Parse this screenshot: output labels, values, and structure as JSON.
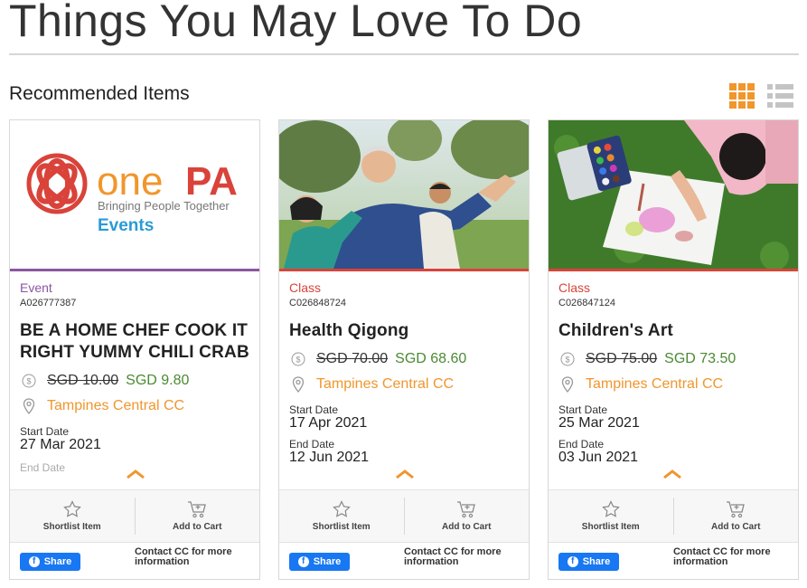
{
  "page": {
    "title": "Things You May Love To Do"
  },
  "section": {
    "title": "Recommended Items"
  },
  "colors": {
    "accent": "#f0962c",
    "event": "#8b56a0",
    "class": "#d9433a",
    "price": "#4a8a32",
    "facebook": "#1877f2"
  },
  "logo": {
    "brand_one": "one",
    "brand_pa": "PA",
    "tagline": "Bringing People Together",
    "sub": "Events"
  },
  "cards": [
    {
      "category": "Event",
      "code": "A026777387",
      "name": "BE A HOME CHEF COOK IT RIGHT YUMMY CHILI CRAB",
      "old_price": "SGD 10.00",
      "new_price": "SGD 9.80",
      "location": "Tampines Central CC",
      "start_label": "Start Date",
      "start_date": "27 Mar 2021",
      "end_label": "End Date",
      "end_date": "",
      "shortlist": "Shortlist Item",
      "add_cart": "Add to Cart",
      "share": "Share",
      "contact": "Contact CC for more information"
    },
    {
      "category": "Class",
      "code": "C026848724",
      "name": "Health Qigong",
      "old_price": "SGD 70.00",
      "new_price": "SGD 68.60",
      "location": "Tampines Central CC",
      "start_label": "Start Date",
      "start_date": "17 Apr 2021",
      "end_label": "End Date",
      "end_date": "12 Jun 2021",
      "shortlist": "Shortlist Item",
      "add_cart": "Add to Cart",
      "share": "Share",
      "contact": "Contact CC for more information"
    },
    {
      "category": "Class",
      "code": "C026847124",
      "name": "Children's Art",
      "old_price": "SGD 75.00",
      "new_price": "SGD 73.50",
      "location": "Tampines Central CC",
      "start_label": "Start Date",
      "start_date": "25 Mar 2021",
      "end_label": "End Date",
      "end_date": "03 Jun 2021",
      "shortlist": "Shortlist Item",
      "add_cart": "Add to Cart",
      "share": "Share",
      "contact": "Contact CC for more information"
    }
  ]
}
